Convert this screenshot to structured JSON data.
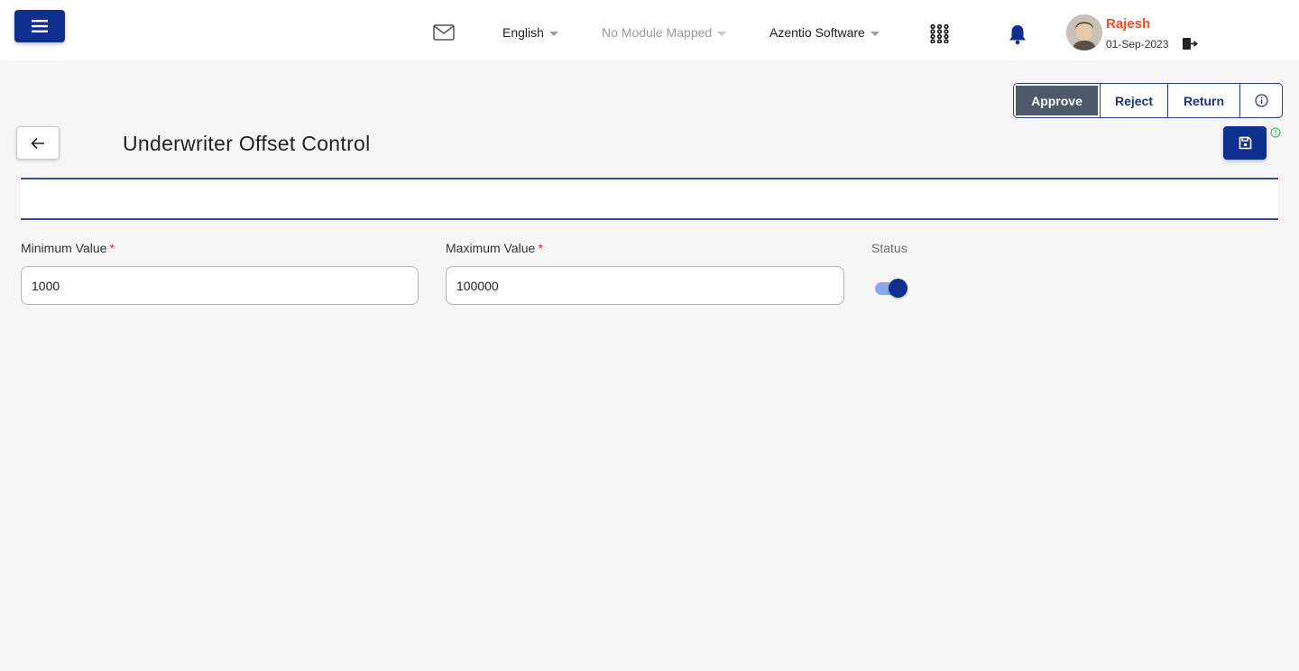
{
  "header": {
    "language": "English",
    "module": "No Module Mapped",
    "company": "Azentio Software",
    "user_name": "Rajesh",
    "user_date": "01-Sep-2023"
  },
  "actions": {
    "approve": "Approve",
    "reject": "Reject",
    "return": "Return"
  },
  "page": {
    "title": "Underwriter Offset Control"
  },
  "form": {
    "min_label": "Minimum Value",
    "min_value": "1000",
    "max_label": "Maximum Value",
    "max_value": "100000",
    "required_mark": "*",
    "status_label": "Status",
    "status_on": true
  },
  "colors": {
    "primary": "#0f2f8f",
    "accent_user": "#f04e23",
    "approve_bg": "#4d5868",
    "required": "#e12a2a"
  },
  "icons": [
    "hamburger-icon",
    "mail-icon",
    "caret-down-icon",
    "apps-grid-icon",
    "bell-icon",
    "logout-icon",
    "info-icon",
    "arrow-left-icon",
    "save-icon",
    "status-info-icon"
  ]
}
